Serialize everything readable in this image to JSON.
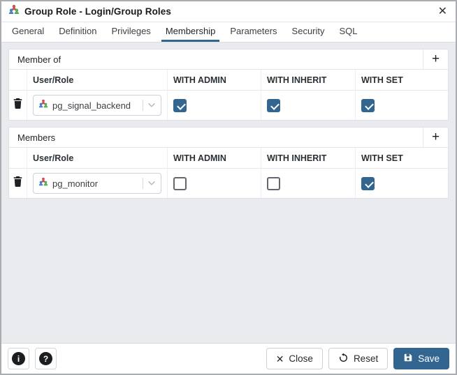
{
  "colors": {
    "primary": "#326690"
  },
  "window": {
    "title": "Group Role - Login/Group Roles",
    "icon": "group-role-icon",
    "close_glyph": "✕"
  },
  "tabs": {
    "items": [
      {
        "label": "General",
        "active": false
      },
      {
        "label": "Definition",
        "active": false
      },
      {
        "label": "Privileges",
        "active": false
      },
      {
        "label": "Membership",
        "active": true
      },
      {
        "label": "Parameters",
        "active": false
      },
      {
        "label": "Security",
        "active": false
      },
      {
        "label": "SQL",
        "active": false
      }
    ]
  },
  "member_of": {
    "title": "Member of",
    "add_glyph": "+",
    "columns": [
      "User/Role",
      "WITH ADMIN",
      "WITH INHERIT",
      "WITH SET"
    ],
    "row": {
      "role": "pg_signal_backend",
      "with_admin": true,
      "with_inherit": true,
      "with_set": true
    }
  },
  "members": {
    "title": "Members",
    "add_glyph": "+",
    "columns": [
      "User/Role",
      "WITH ADMIN",
      "WITH INHERIT",
      "WITH SET"
    ],
    "row": {
      "role": "pg_monitor",
      "with_admin": false,
      "with_inherit": false,
      "with_set": true
    }
  },
  "footer": {
    "info_glyph": "i",
    "help_glyph": "?",
    "close_glyph": "✕",
    "close_label": "Close",
    "reset_label": "Reset",
    "save_label": "Save"
  }
}
